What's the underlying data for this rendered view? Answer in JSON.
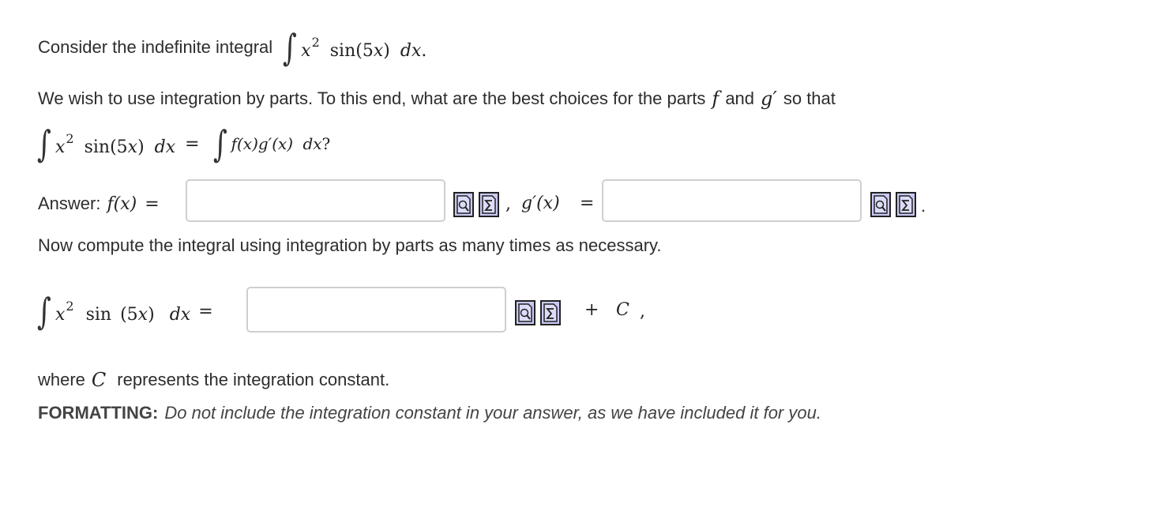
{
  "intro": {
    "prefix": "Consider the indefinite integral",
    "integrand": "x",
    "exponent": "2",
    "sin_part": "sin(5",
    "sin_x": "x",
    "sin_close": ")",
    "dx": "dx",
    "end": "."
  },
  "parts_question": {
    "text_before": "We wish to use integration by parts.  To this end, what are the best choices for the parts",
    "f": "f",
    "and": "and",
    "g_prime": "g′",
    "text_after": "so that",
    "lhs_x": "x",
    "lhs_exp": "2",
    "lhs_sin": "sin(5",
    "lhs_sin_x": "x",
    "lhs_close": ")",
    "lhs_dx": "dx",
    "equals": "=",
    "rhs": "f(x)g′(x)",
    "rhs_dx": "dx",
    "question_mark": "?"
  },
  "answer_row": {
    "label": "Answer:",
    "f_expr": "f(x)",
    "equals": "=",
    "f_value": "",
    "separator": ",",
    "g_expr": "g′(x)",
    "g_equals": "=",
    "g_value": "",
    "end": "."
  },
  "compute_instruction": "Now compute the integral using integration by parts as many times as necessary.",
  "integral_answer": {
    "x": "x",
    "exp": "2",
    "sin": "sin",
    "arg": "(5",
    "arg_x": "x",
    "arg_close": ")",
    "dx": "dx",
    "equals": "=",
    "value": "",
    "plus": "+",
    "constant": "C",
    "comma": ","
  },
  "constant_note": {
    "prefix": "where",
    "symbol": "C",
    "suffix": "represents the integration constant."
  },
  "formatting_note": {
    "label": "FORMATTING:",
    "text": "Do not include the integration constant in your answer, as we have included it for you."
  },
  "icons": {
    "preview": "preview-icon",
    "equation_editor": "equation-editor-icon",
    "button_fill": "#c8c8f4"
  }
}
